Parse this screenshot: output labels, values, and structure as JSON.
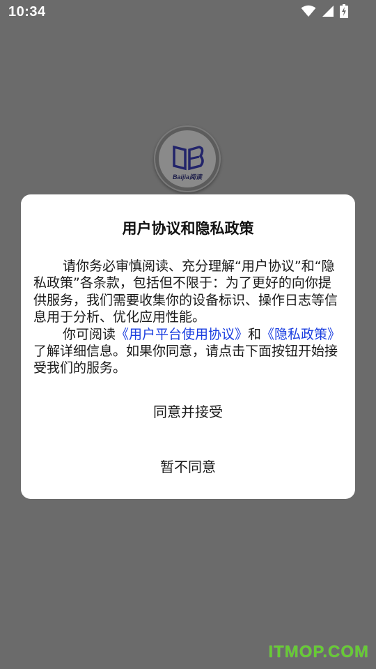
{
  "status_bar": {
    "time": "10:34",
    "icons": [
      "wifi-icon",
      "signal-icon",
      "battery-charging-icon"
    ]
  },
  "logo": {
    "text": "Baijia阅读"
  },
  "dialog": {
    "title": "用户协议和隐私政策",
    "para1": "请你务必审慎阅读、充分理解“用户协议”和“隐私政策”各条款，包括但不限于：为了更好的向你提供服务，我们需要收集你的设备标识、操作日志等信息用于分析、优化应用性能。",
    "para2_prefix": "你可阅读",
    "user_agreement_link": "《用户平台使用协议》",
    "para2_and": "和",
    "privacy_link": "《隐私政策》",
    "para2_suffix": "了解详细信息。如果你同意，请点击下面按钮开始接受我们的服务。",
    "accept_label": "同意并接受",
    "decline_label": "暂不同意"
  },
  "watermark": {
    "text": "ITMOP.COM"
  },
  "colors": {
    "overlay": "#6b6b6b",
    "link": "#1a3ee0",
    "watermark": "#66cc33"
  }
}
